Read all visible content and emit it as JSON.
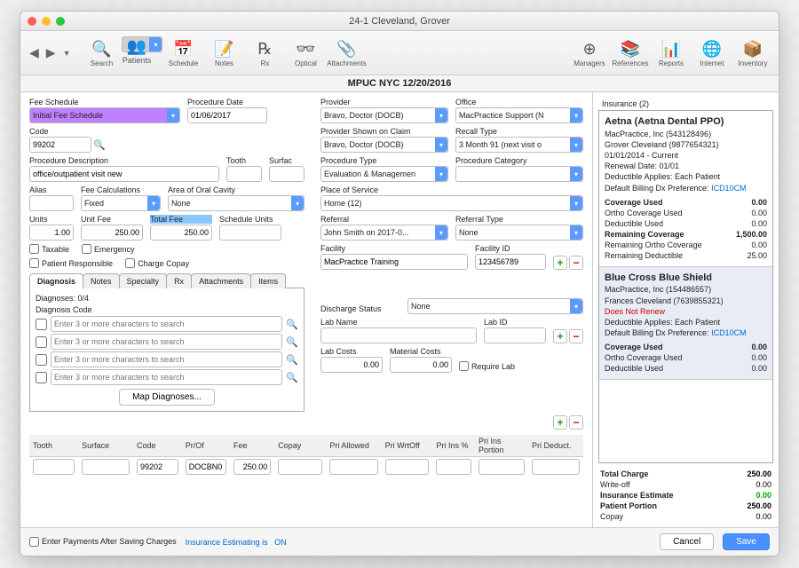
{
  "window": {
    "title": "24-1      Cleveland, Grover"
  },
  "toolbar": {
    "left": [
      "Search",
      "Patients",
      "Schedule",
      "Notes",
      "Rx",
      "Optical",
      "Attachments"
    ],
    "right": [
      "Managers",
      "References",
      "Reports",
      "Internet",
      "Inventory"
    ],
    "selected": "Patients"
  },
  "header": "MPUC NYC 12/20/2016",
  "form": {
    "fee_schedule_lbl": "Fee Schedule",
    "fee_schedule": "Initial Fee Schedule",
    "proc_date_lbl": "Procedure Date",
    "proc_date": "01/06/2017",
    "code_lbl": "Code",
    "code": "99202",
    "proc_desc_lbl": "Procedure Description",
    "proc_desc": "office/outpatient visit new",
    "alias_lbl": "Alias",
    "alias": "",
    "fee_calc_lbl": "Fee Calculations",
    "fee_calc": "Fixed",
    "tooth_lbl": "Tooth",
    "tooth": "",
    "surface_lbl": "Surfac",
    "surface": "",
    "aoc_lbl": "Area of Oral Cavity",
    "aoc": "None",
    "units_lbl": "Units",
    "units": "1.00",
    "unit_fee_lbl": "Unit Fee",
    "unit_fee": "250.00",
    "total_fee_lbl": "Total Fee",
    "total_fee": "250.00",
    "sched_units_lbl": "Schedule Units",
    "sched_units": "",
    "taxable": "Taxable",
    "emergency": "Emergency",
    "patient_resp": "Patient Responsible",
    "charge_copay": "Charge Copay",
    "provider_lbl": "Provider",
    "provider": "Bravo, Doctor (DOCB)",
    "office_lbl": "Office",
    "office": "MacPractice Support (N",
    "psoc_lbl": "Provider Shown on Claim",
    "psoc": "Bravo, Doctor (DOCB)",
    "recall_lbl": "Recall Type",
    "recall": "3 Month 91 (next visit o",
    "proc_type_lbl": "Procedure Type",
    "proc_type": "Evaluation & Managemen",
    "proc_cat_lbl": "Procedure Category",
    "proc_cat": "",
    "pos_lbl": "Place of Service",
    "pos": "Home (12)",
    "referral_lbl": "Referral",
    "referral": "John Smith on 2017-0...",
    "ref_type_lbl": "Referral Type",
    "ref_type": "None",
    "facility_lbl": "Facility",
    "facility": "MacPractice Training",
    "facility_id_lbl": "Facility ID",
    "facility_id": "123456789",
    "discharge_lbl": "Discharge Status",
    "discharge": "None",
    "lab_name_lbl": "Lab Name",
    "lab_name": "",
    "lab_id_lbl": "Lab ID",
    "lab_id": "",
    "lab_costs_lbl": "Lab Costs",
    "lab_costs": "0.00",
    "mat_costs_lbl": "Material Costs",
    "mat_costs": "0.00",
    "require_lab": "Require Lab"
  },
  "tabs": [
    "Diagnosis",
    "Notes",
    "Specialty",
    "Rx",
    "Attachments",
    "Items"
  ],
  "diag": {
    "count_lbl": "Diagnoses:  0/4",
    "code_lbl": "Diagnosis Code",
    "placeholder": "Enter 3 or more characters to search",
    "map_btn": "Map Diagnoses..."
  },
  "grid": {
    "headers": [
      "Tooth",
      "Surface",
      "Code",
      "Pr/Of",
      "Fee",
      "Copay",
      "Pri Allowed",
      "Pri WrtOff",
      "Pri Ins %",
      "Pri Ins Portion",
      "Pri Deduct."
    ],
    "row": {
      "code": "99202",
      "prof": "DOCBN0",
      "fee": "250.00"
    }
  },
  "footer": {
    "enter_pay": "Enter Payments After Saving Charges",
    "est_lbl": "Insurance Estimating is",
    "est_val": "ON",
    "cancel": "Cancel",
    "save": "Save"
  },
  "insurance": {
    "header": "Insurance (2)",
    "cards": [
      {
        "name": "Aetna (Aetna Dental PPO)",
        "lines": [
          "MacPractice, Inc (543128496)",
          "Grover Cleveland (9877654321)",
          "01/01/2014 - Current",
          "Renewal Date: 01/01",
          "Deductible Applies: Each Patient"
        ],
        "pref_lbl": "Default Billing Dx Preference: ",
        "pref": "ICD10CM",
        "kv": [
          [
            "Coverage Used",
            "0.00",
            true
          ],
          [
            "Ortho Coverage Used",
            "0.00",
            false
          ],
          [
            "Deductible Used",
            "0.00",
            false
          ],
          [
            "Remaining Coverage",
            "1,500.00",
            true
          ],
          [
            "Remaining Ortho Coverage",
            "0.00",
            false
          ],
          [
            "Remaining Deductible",
            "25.00",
            false
          ]
        ]
      },
      {
        "name": "Blue Cross Blue Shield",
        "lines": [
          "MacPractice, Inc (154486557)",
          "Frances Cleveland (7639855321)"
        ],
        "red": "Does Not Renew",
        "lines2": [
          "Deductible Applies: Each Patient"
        ],
        "pref_lbl": "Default Billing Dx Preference: ",
        "pref": "ICD10CM",
        "kv": [
          [
            "Coverage Used",
            "0.00",
            true
          ],
          [
            "Ortho Coverage Used",
            "0.00",
            false
          ],
          [
            "Deductible Used",
            "0.00",
            false
          ]
        ]
      }
    ],
    "totals": [
      [
        "Total Charge",
        "250.00",
        true,
        "#000"
      ],
      [
        "Write-off",
        "0.00",
        false,
        "#000"
      ],
      [
        "Insurance Estimate",
        "0.00",
        true,
        "#0a0"
      ],
      [
        "Patient Portion",
        "250.00",
        true,
        "#000"
      ],
      [
        "Copay",
        "0.00",
        false,
        "#000"
      ]
    ]
  }
}
